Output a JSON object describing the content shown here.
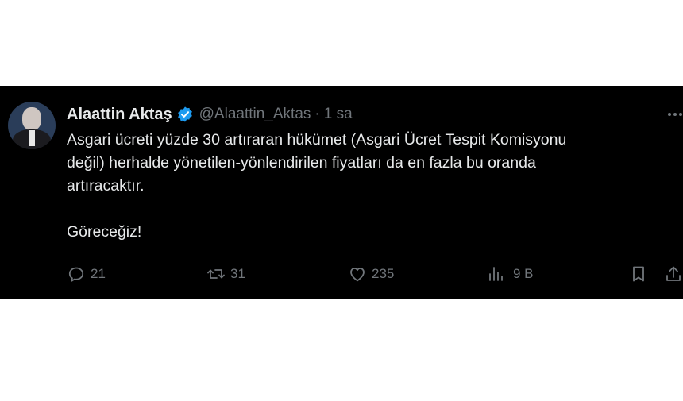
{
  "tweet": {
    "author": {
      "name": "Alaattin Aktaş",
      "handle": "@Alaattin_Aktas",
      "time": "1 sa",
      "separator": "·",
      "verified": true
    },
    "text_lines": [
      "Asgari ücreti yüzde 30 artıraran hükümet (Asgari Ücret Tespit Komisyonu",
      "değil) herhalde yönetilen-yönlendirilen fiyatları da en fazla bu oranda",
      "artıracaktır.",
      "Göreceğiz!"
    ],
    "actions": {
      "reply": {
        "icon": "reply-icon",
        "count": "21"
      },
      "retweet": {
        "icon": "retweet-icon",
        "count": "31"
      },
      "like": {
        "icon": "heart-icon",
        "count": "235"
      },
      "views": {
        "icon": "views-chart-icon",
        "count": "9 B"
      },
      "bookmark": {
        "icon": "bookmark-icon"
      },
      "share": {
        "icon": "share-icon"
      }
    }
  },
  "colors": {
    "background": "#000000",
    "text": "#e7e9ea",
    "secondary": "#71767b",
    "verified": "#1d9bf0"
  }
}
